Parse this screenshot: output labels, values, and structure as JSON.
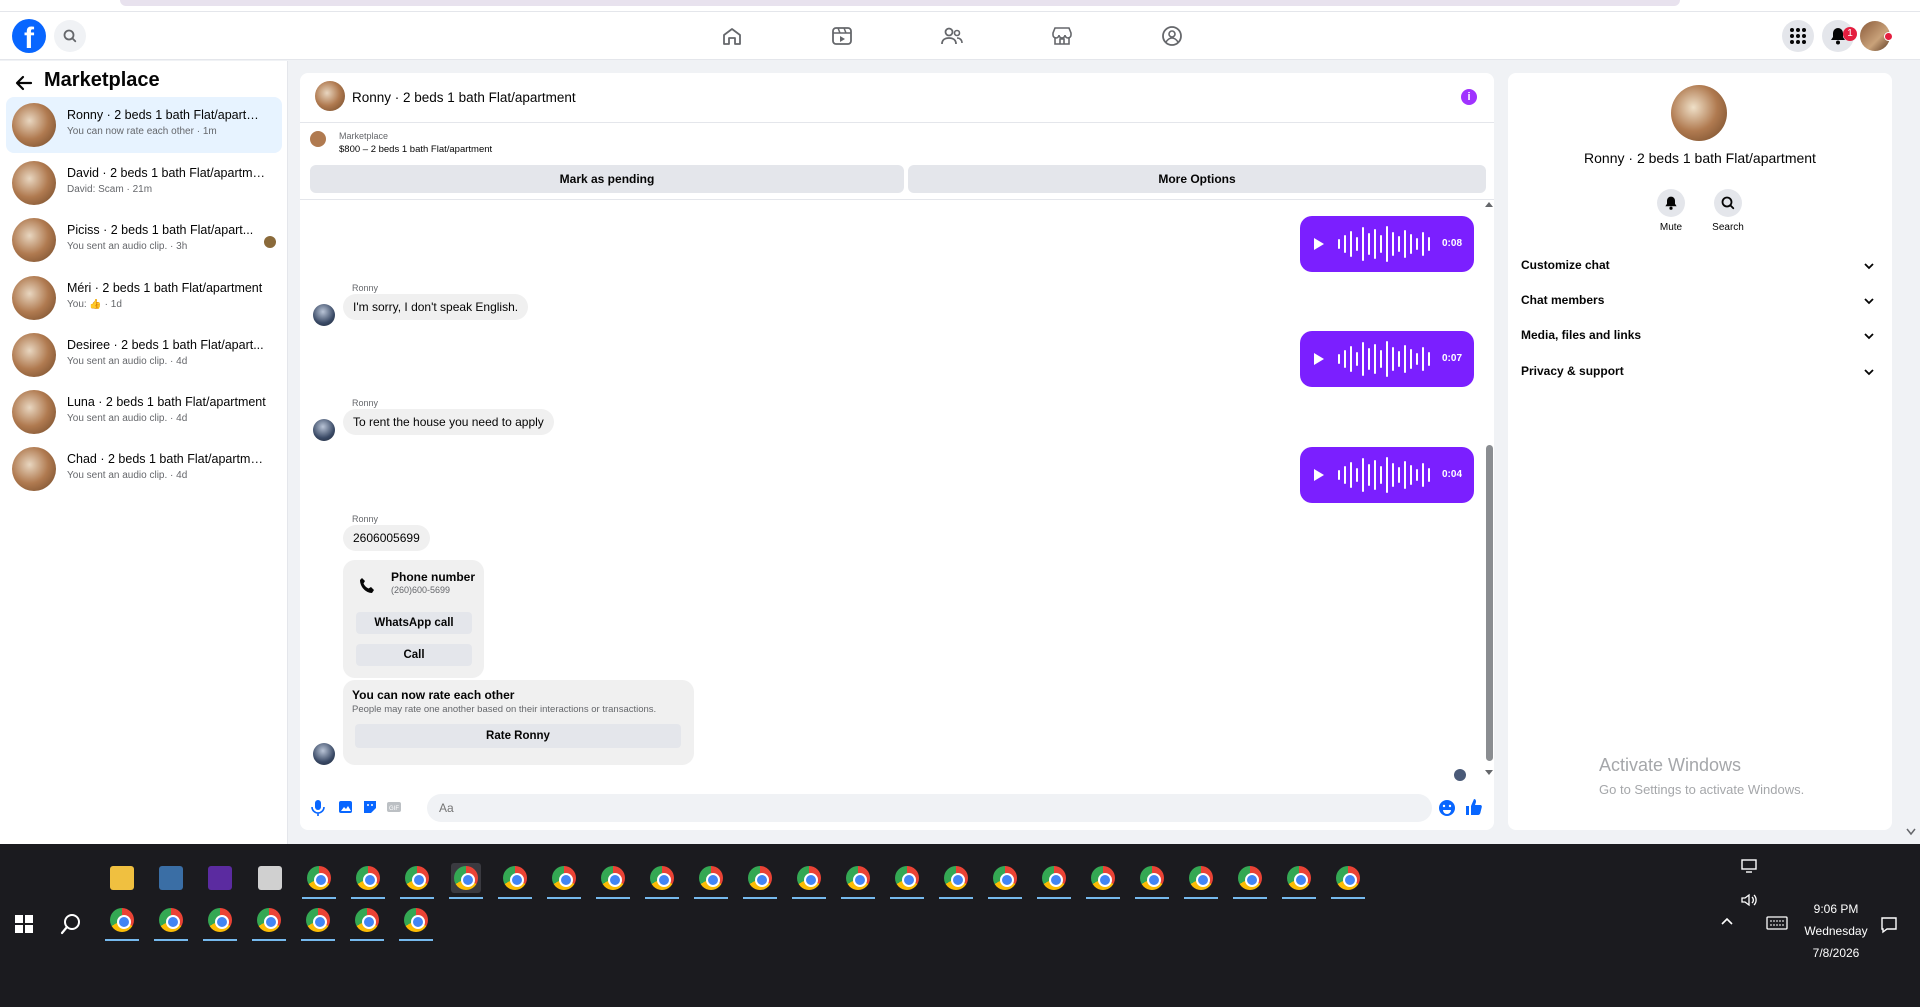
{
  "sidebar": {
    "title": "Marketplace",
    "conversations": [
      {
        "name": "Ronny · 2 beds 1 bath Flat/apartm...",
        "preview": "You can now rate each other · 1m",
        "active": true
      },
      {
        "name": "David · 2 beds 1 bath Flat/apartment",
        "preview": "David: Scam · 21m"
      },
      {
        "name": "Piciss · 2 beds 1 bath Flat/apart...",
        "preview": "You sent an audio clip. · 3h"
      },
      {
        "name": "Méri · 2 beds 1 bath Flat/apartment",
        "preview": "You: 👍 · 1d"
      },
      {
        "name": "Desiree · 2 beds 1 bath Flat/apart...",
        "preview": "You sent an audio clip. · 4d"
      },
      {
        "name": "Luna · 2 beds 1 bath Flat/apartment",
        "preview": "You sent an audio clip. · 4d"
      },
      {
        "name": "Chad · 2 beds 1 bath Flat/apartment",
        "preview": "You sent an audio clip. · 4d"
      }
    ]
  },
  "chat": {
    "title": "Ronny · 2 beds 1 bath Flat/apartment",
    "listing": {
      "label": "Marketplace",
      "price_title": "$800 – 2 beds 1 bath Flat/apartment"
    },
    "actions": {
      "pending": "Mark as pending",
      "more": "More Options"
    },
    "voice_durations": [
      "0:08",
      "0:07",
      "0:04"
    ],
    "sender": "Ronny",
    "messages": {
      "m1": "I'm sorry, I don't speak English.",
      "m2": "To rent the house you need to apply",
      "m3": "2606005699"
    },
    "phone_card": {
      "title": "Phone number",
      "number": "(260)600-5699",
      "whatsapp": "WhatsApp call",
      "call": "Call"
    },
    "rate_card": {
      "title": "You can now rate each other",
      "desc": "People may rate one another based on their interactions or transactions.",
      "button": "Rate Ronny"
    },
    "composer_placeholder": "Aa"
  },
  "right_panel": {
    "title": "Ronny · 2 beds 1 bath Flat/apartment",
    "mute": "Mute",
    "search": "Search",
    "sections": [
      "Customize chat",
      "Chat members",
      "Media, files and links",
      "Privacy & support"
    ]
  },
  "watermark": {
    "title": "Activate Windows",
    "subtitle": "Go to Settings to activate Windows."
  },
  "topnav": {
    "notif_count": "1"
  },
  "taskbar": {
    "time": "9:06 PM",
    "day": "Wednesday",
    "date": "7/8/2026"
  },
  "colors": {
    "accent": "#7b1fff",
    "brand": "#0866ff",
    "badge": "#e41e3f"
  }
}
